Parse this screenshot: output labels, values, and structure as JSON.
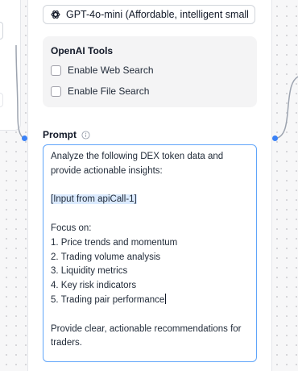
{
  "model": {
    "icon": "openai-logo-icon",
    "selected": "GPT-4o-mini (Affordable, intelligent small m"
  },
  "tools": {
    "title": "OpenAI Tools",
    "options": [
      {
        "label": "Enable Web Search",
        "checked": false
      },
      {
        "label": "Enable File Search",
        "checked": false
      }
    ]
  },
  "prompt": {
    "label": "Prompt",
    "info_icon": "info-icon",
    "lines": [
      "Analyze the following DEX token data and provide actionable insights:",
      "",
      "[Input from apiCall-1]",
      "",
      "Focus on:",
      "1. Price trends and momentum",
      "2. Trading volume analysis",
      "3. Liquidity metrics",
      "4. Key risk indicators",
      "5. Trading pair performance",
      "",
      "Provide clear, actionable recommendations for traders."
    ]
  },
  "colors": {
    "accent": "#3b82f6",
    "focus_border": "#60a5fa",
    "selection": "#dbeafe",
    "card_bg": "#f4f4f5"
  }
}
